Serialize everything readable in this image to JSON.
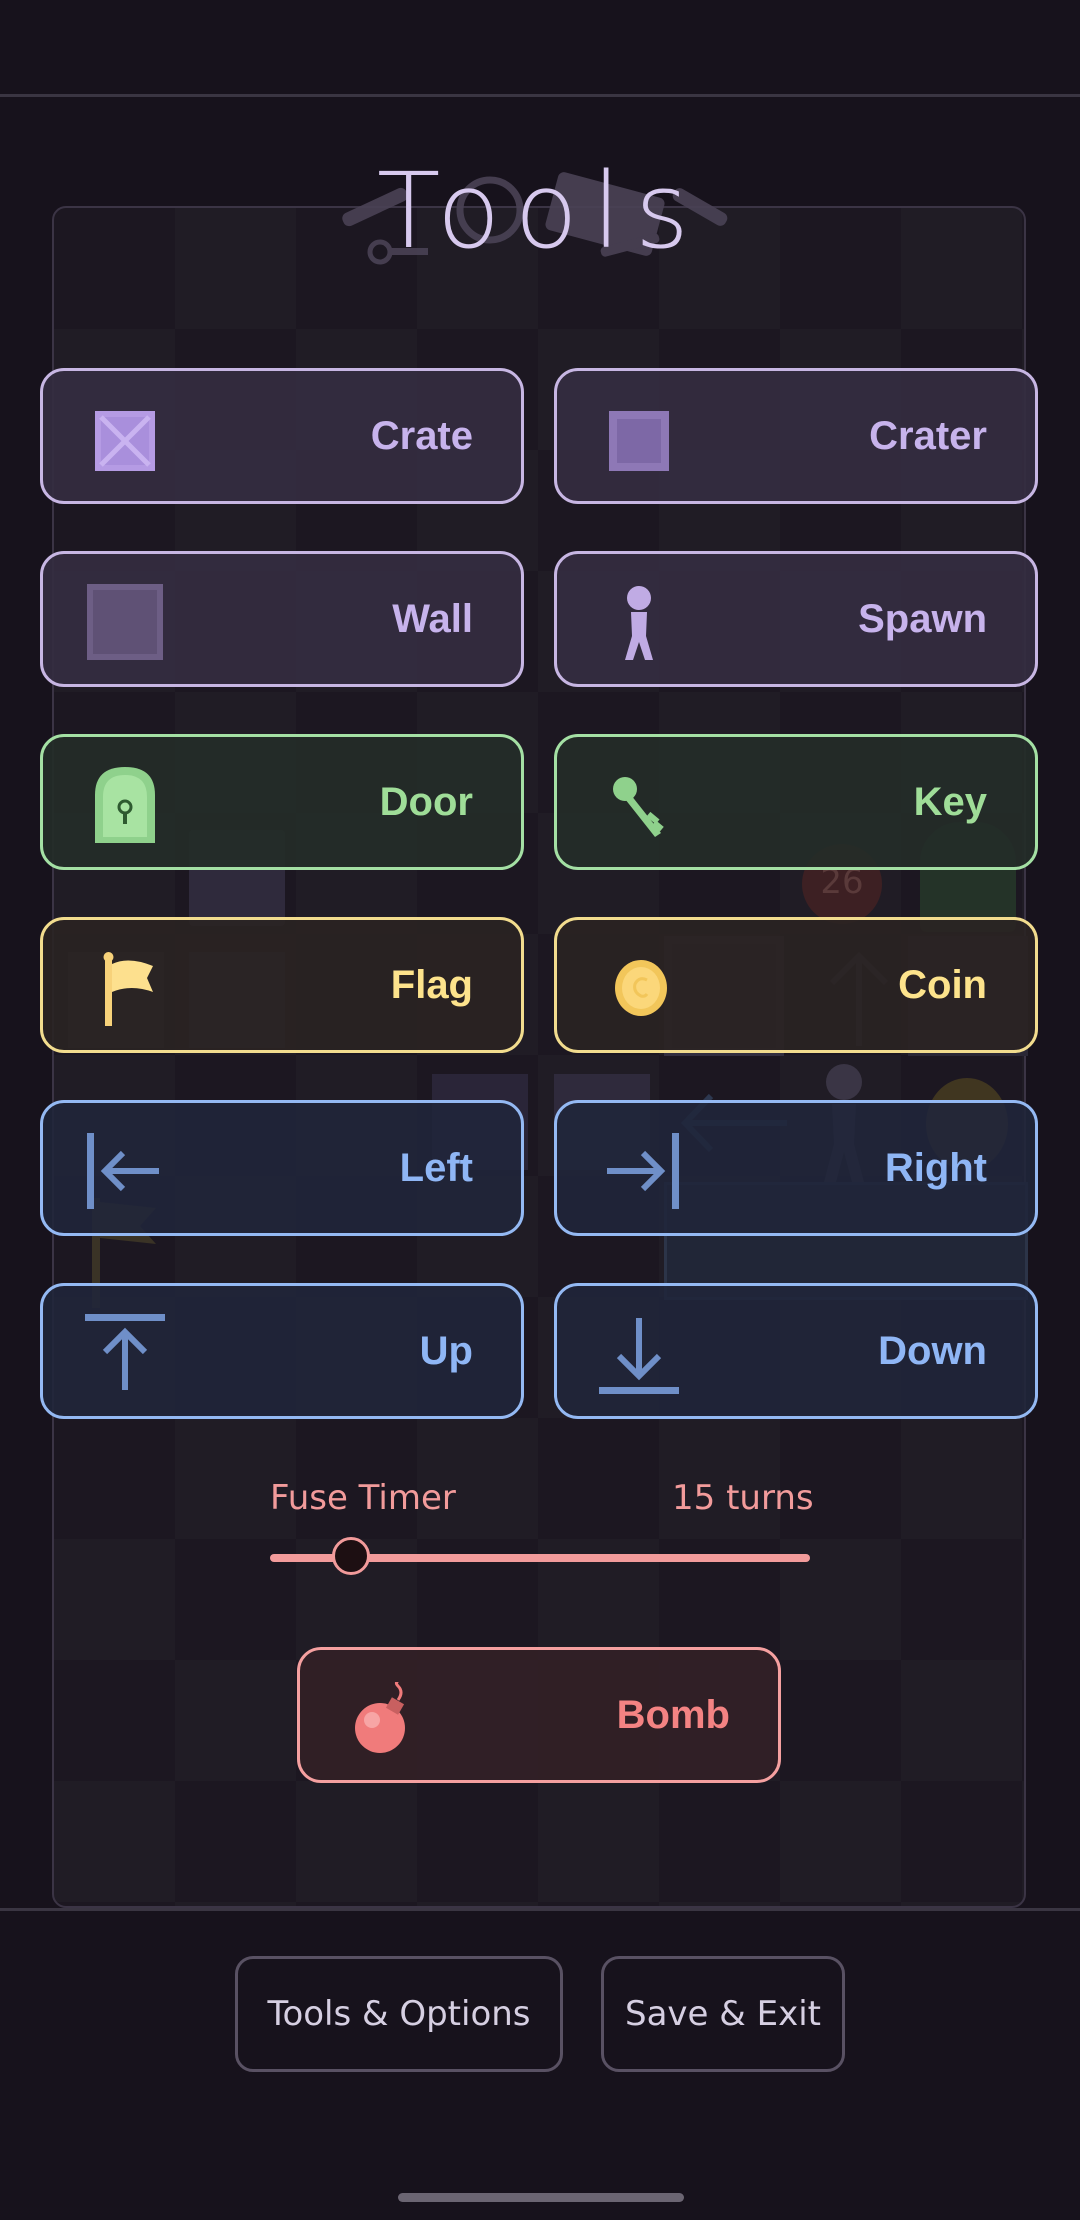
{
  "title": "Tools",
  "tools": {
    "crate": "Crate",
    "crater": "Crater",
    "wall": "Wall",
    "spawn": "Spawn",
    "door": "Door",
    "key": "Key",
    "flag": "Flag",
    "coin": "Coin",
    "left": "Left",
    "right": "Right",
    "up": "Up",
    "down": "Down"
  },
  "fuse": {
    "label": "Fuse Timer",
    "value_text": "15 turns",
    "slider_fraction": 0.15
  },
  "bomb": {
    "label": "Bomb"
  },
  "board": {
    "bomb_count": "26"
  },
  "bottom": {
    "tools_options": "Tools & Options",
    "save_exit": "Save & Exit"
  },
  "colors": {
    "purple": "#c7b3ec",
    "green": "#9fdd98",
    "yellow": "#fde38c",
    "blue": "#8fb6f5",
    "red": "#f48383"
  }
}
